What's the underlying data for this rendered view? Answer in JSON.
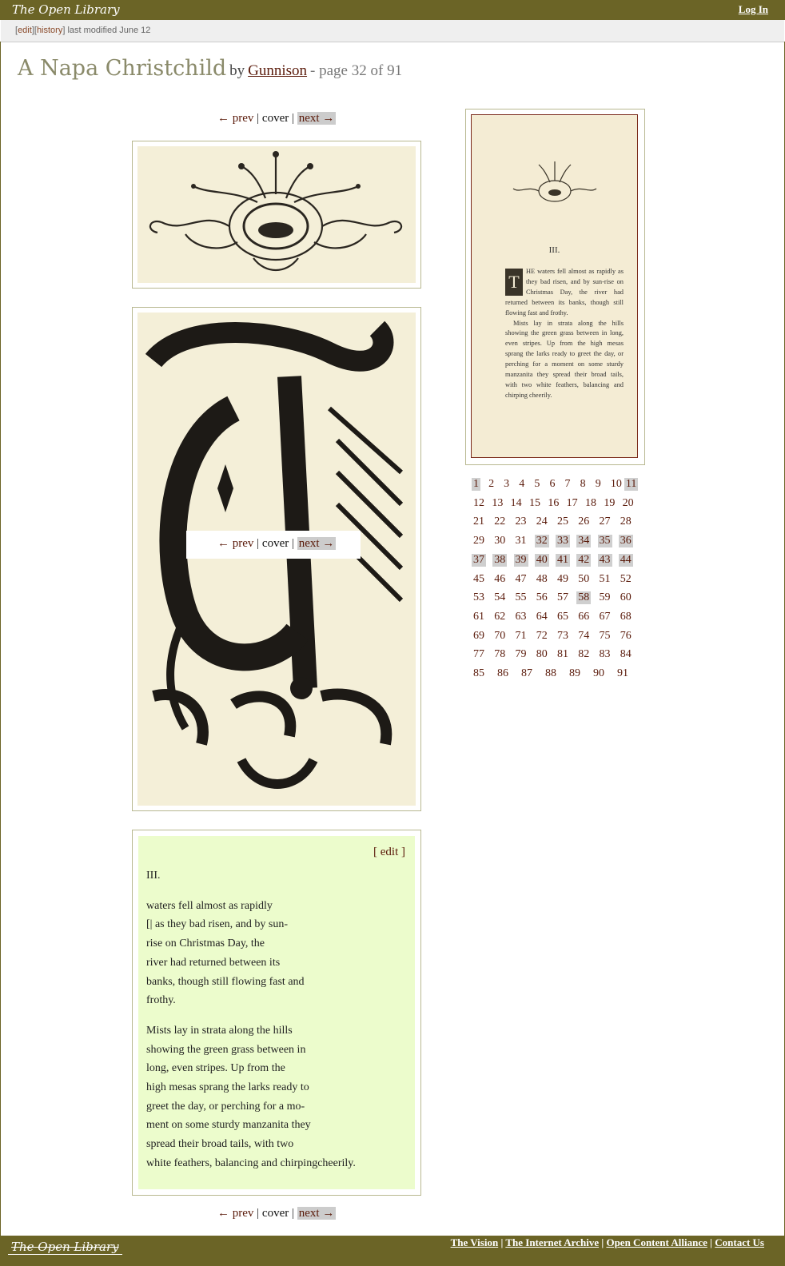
{
  "header": {
    "brand": "The Open Library",
    "login": "Log In"
  },
  "editbar": {
    "edit": "edit",
    "history": "history",
    "modified": "last modified June 12"
  },
  "title": {
    "book": "A Napa Christchild",
    "by": "by",
    "author": "Gunnison",
    "page_info": "- page 32 of 91"
  },
  "pager": {
    "prev": "← prev",
    "sep": "|",
    "cover": "cover",
    "next": "next →"
  },
  "thumbnail": {
    "heading": "III.",
    "para1": "HE waters fell almost as rapidly as they bad risen, and by sun-rise on Christmas Day, the river had returned between its banks, though still flowing fast and frothy.",
    "para2": "Mists lay in strata along the hills showing the green grass between in long, even stripes. Up from the high mesas sprang the larks ready to greet the day, or perching for a moment on some sturdy manzanita they spread their broad tails, with two white feathers, balancing and chirping cheerily."
  },
  "ocr": {
    "edit": "[ edit ]",
    "heading": "III.",
    "para1": [
      "waters fell almost as rapidly",
      "[| as they bad risen, and by sun-",
      "rise on Christmas Day, the",
      "river had returned between its",
      "banks, though still flowing fast and",
      "frothy."
    ],
    "para2": [
      "Mists lay in strata along the hills",
      "showing the green grass between in",
      "long, even stripes. Up from the",
      "high mesas sprang the larks ready to",
      "greet the day, or perching for a mo-",
      "ment on some sturdy manzanita they",
      "spread their broad tails, with two",
      "white feathers, balancing and chirpingcheerily."
    ]
  },
  "pages": {
    "rows": [
      [
        "1",
        "2",
        "3",
        "4",
        "5",
        "6",
        "7",
        "8",
        "9",
        "10",
        "11"
      ],
      [
        "12",
        "13",
        "14",
        "15",
        "16",
        "17",
        "18",
        "19",
        "20"
      ],
      [
        "21",
        "22",
        "23",
        "24",
        "25",
        "26",
        "27",
        "28"
      ],
      [
        "29",
        "30",
        "31",
        "32",
        "33",
        "34",
        "35",
        "36"
      ],
      [
        "37",
        "38",
        "39",
        "40",
        "41",
        "42",
        "43",
        "44"
      ],
      [
        "45",
        "46",
        "47",
        "48",
        "49",
        "50",
        "51",
        "52"
      ],
      [
        "53",
        "54",
        "55",
        "56",
        "57",
        "58",
        "59",
        "60"
      ],
      [
        "61",
        "62",
        "63",
        "64",
        "65",
        "66",
        "67",
        "68"
      ],
      [
        "69",
        "70",
        "71",
        "72",
        "73",
        "74",
        "75",
        "76"
      ],
      [
        "77",
        "78",
        "79",
        "80",
        "81",
        "82",
        "83",
        "84"
      ],
      [
        "85",
        "86",
        "87",
        "88",
        "89",
        "90",
        "91"
      ]
    ],
    "highlighted": [
      "1",
      "11",
      "32",
      "33",
      "34",
      "35",
      "36",
      "37",
      "38",
      "39",
      "40",
      "41",
      "42",
      "43",
      "44",
      "58"
    ]
  },
  "footer": {
    "logo": "The Open Library",
    "links": [
      "The Vision",
      "The Internet Archive",
      "Open Content Alliance",
      "Contact Us"
    ],
    "sep": "|"
  },
  "colors": {
    "bar": "#6b6426",
    "ocr_bg": "#ecfccc",
    "link": "#5a1a0a",
    "page_highlight": "#cfcfcf"
  }
}
